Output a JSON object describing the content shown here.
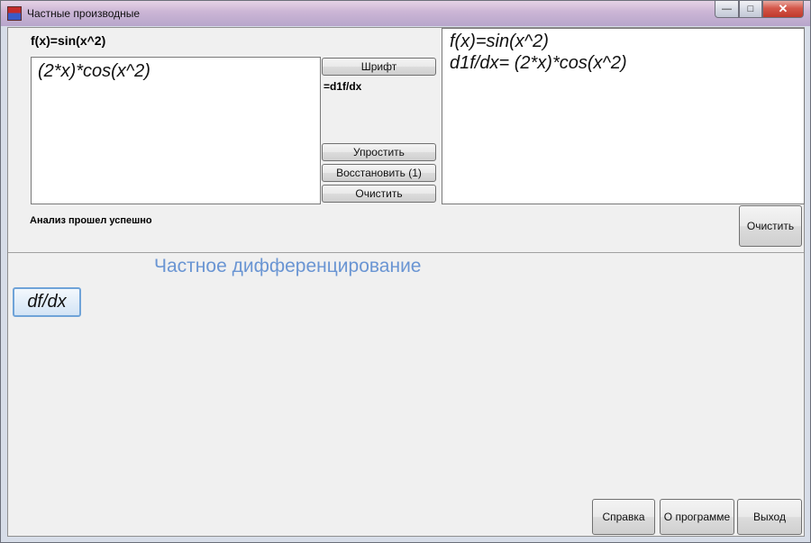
{
  "window": {
    "title": "Частные производные",
    "minimize_glyph": "—",
    "maximize_glyph": "□",
    "close_glyph": "✕"
  },
  "input": {
    "function_label": "f(x)=sin(x^2)"
  },
  "result": {
    "text": "(2*x)*cos(x^2)"
  },
  "controls": {
    "font_button": "Шрифт",
    "derivative_label": "=d1f/dx",
    "simplify_button": "Упростить",
    "restore_button": "Восстановить (1)",
    "clear_button": "Очистить"
  },
  "output": {
    "line1": "f(x)=sin(x^2)",
    "line2": "d1f/dx= (2*x)*cos(x^2)"
  },
  "status": {
    "message": "Анализ прошел успешно",
    "clear_button": "Очистить"
  },
  "section": {
    "title": "Частное дифференцирование",
    "dfdx_button": "df/dx"
  },
  "footer": {
    "help_button": "Справка",
    "about_button": "О программе",
    "exit_button": "Выход"
  },
  "colors": {
    "section_title": "#6a95d3",
    "active_button_border": "#6fa3d8"
  }
}
